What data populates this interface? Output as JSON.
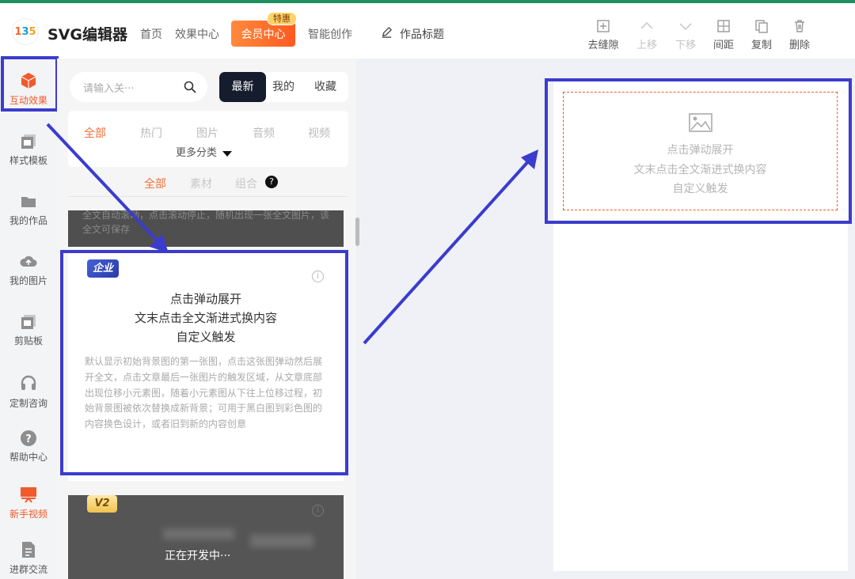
{
  "header": {
    "app_title": "SVG编辑器",
    "logo_text": "135",
    "nav": [
      "首页",
      "效果中心"
    ],
    "vip_label": "会员中心",
    "vip_badge": "特惠",
    "ai_label": "智能创作",
    "work_title": "作品标题",
    "tools": [
      {
        "label": "去缝隙",
        "icon": "plus-square-icon",
        "enabled": true
      },
      {
        "label": "上移",
        "icon": "chevron-up-icon",
        "enabled": false
      },
      {
        "label": "下移",
        "icon": "chevron-down-icon",
        "enabled": false
      },
      {
        "label": "间距",
        "icon": "spacing-icon",
        "enabled": true
      },
      {
        "label": "复制",
        "icon": "copy-icon",
        "enabled": true
      },
      {
        "label": "删除",
        "icon": "trash-icon",
        "enabled": true
      }
    ]
  },
  "sidebar": {
    "items": [
      {
        "label": "互动效果",
        "icon": "cube-icon",
        "active": true
      },
      {
        "label": "样式模板",
        "icon": "template-icon",
        "active": false
      },
      {
        "label": "我的作品",
        "icon": "folder-icon",
        "active": false
      },
      {
        "label": "我的图片",
        "icon": "cloud-upload-icon",
        "active": false
      },
      {
        "label": "剪贴板",
        "icon": "clipboard-icon",
        "active": false
      },
      {
        "label": "定制咨询",
        "icon": "headset-icon",
        "active": false
      },
      {
        "label": "帮助中心",
        "icon": "help-icon",
        "active": false
      },
      {
        "label": "新手视频",
        "icon": "video-icon",
        "active": true
      },
      {
        "label": "进群交流",
        "icon": "doc-icon",
        "active": false
      }
    ]
  },
  "panel": {
    "search_placeholder": "请输入关···",
    "segments": [
      "最新",
      "我的",
      "收藏"
    ],
    "categories": [
      "全部",
      "热门",
      "图片",
      "音频",
      "视频"
    ],
    "more_categories": "更多分类",
    "sub_tabs": [
      "全部",
      "素材",
      "组合"
    ],
    "sub_help": "?",
    "cards": [
      {
        "partial_text": "全文自动滚动，点击滚动停止，随机出现一张全文图片，该全文可保存"
      },
      {
        "tag": "企业",
        "info": "i",
        "title_lines": [
          "点击弹动展开",
          "文末点击全文渐进式换内容",
          "自定义触发"
        ],
        "description": "默认显示初始背景图的第一张图，点击这张图弹动然后展开全文，点击文章最后一张图片的触发区域，从文章底部出现位移小元素图，随着小元素图从下往上位移过程，初始背景图被依次替换成新背景；可用于黑白图到彩色图的内容换色设计，或者旧到新的内容创意"
      },
      {
        "tag": "V2",
        "info": "i",
        "loading": "正在开发中···"
      }
    ]
  },
  "canvas": {
    "lines": [
      "点击弹动展开",
      "文末点击全文渐进式换内容",
      "自定义触发"
    ]
  },
  "colors": {
    "accent": "#f05a2c",
    "highlight": "#3b3ccd",
    "brand_green": "#1e8f5e"
  }
}
